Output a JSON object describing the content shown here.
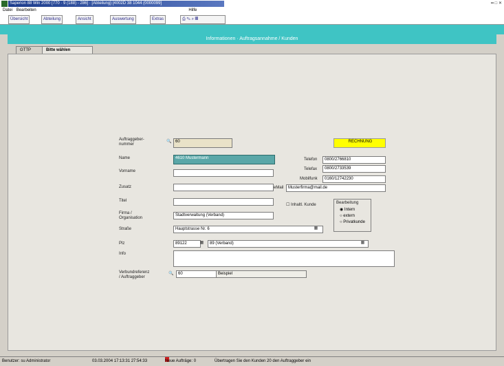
{
  "window": {
    "title": "Saperion 88 Win 2000 [770 · 9 (188) - 286] · [Abteilung]·[4002D 38 1044 (0000099]",
    "controls": "▪▪ □ ✕"
  },
  "menu": [
    "Datei",
    "Bearbeiten",
    "Hilfe"
  ],
  "toolbar": {
    "buttons": [
      "Übersicht",
      "Abteilung",
      "Ansicht",
      "Auswertung",
      "Extras"
    ]
  },
  "header": {
    "title": "Informationen · Auftragsannahme / Kunden"
  },
  "tabs": [
    {
      "label": "GTTP",
      "active": false
    },
    {
      "label": "Bitte wählen",
      "active": true
    }
  ],
  "form": {
    "auftraggeber_label": "Auftraggeber-nummer",
    "auftraggeber_value": "60",
    "status_value": "RECHNUNG",
    "name_label": "Name",
    "name_value": "4610 Mustermann",
    "vorname_label": "Vorname",
    "vorname_value": "",
    "zusatz_label": "Zusatz",
    "zusatz_value": "",
    "titel_label": "Titel",
    "titel_value": "",
    "firma_label": "Firma / Organisation",
    "firma_value": "Stadtverwaltung (Verband)",
    "strasse_label": "Straße",
    "strasse_value": "Hauptstrasse Nr. 6",
    "plz_label": "Plz",
    "plz_value": "89122",
    "ort_value": "89 (Verband)",
    "info_label": "Info",
    "info_value": "",
    "telefon_label": "Telefon",
    "telefon_value": "0800/2766810",
    "telefax_label": "Telefax",
    "telefax_value": "0800/2733539",
    "mobil_label": "Mobilfunk",
    "mobil_value": "0160/12742230",
    "email_label": "eMail",
    "email_value": "Musterfirma@mail.de",
    "checkbox_label": "Inhaltl. Kunde",
    "group_label": "Bearbeitung",
    "radio_1": "Intern",
    "radio_2": "extern",
    "radio_3": "Privatkunde",
    "verbund_label": "Verbundreferenz / Auftraggeber",
    "verbund_value": "60",
    "verbund_desc": "Beispiel"
  },
  "status": {
    "user": "Benutzer: su Administrator",
    "datetime": "03.03.2004 17:13:31 27:54:33",
    "auftraege": "Neue Aufträge: 0",
    "message": "Übertragen Sie den Kunden 20 den Auftraggeber ein"
  }
}
